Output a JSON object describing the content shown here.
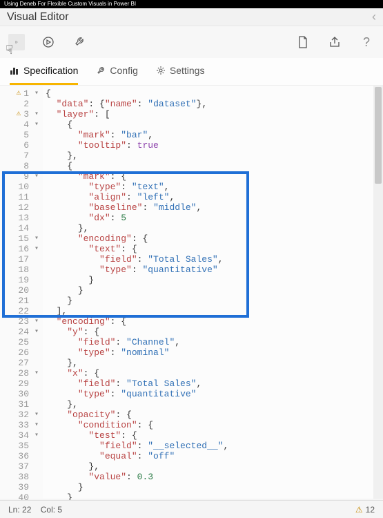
{
  "video_title": "Using Deneb For Flexible Custom Visuals in Power BI",
  "window_title": "Visual Editor",
  "tabs": {
    "spec": "Specification",
    "config": "Config",
    "settings": "Settings"
  },
  "status": {
    "line_label": "Ln:",
    "line": "22",
    "col_label": "Col:",
    "col": "5",
    "warn_count": "12"
  },
  "code": [
    "{",
    "  \"data\": {\"name\": \"dataset\"},",
    "  \"layer\": [",
    "    {",
    "      \"mark\": \"bar\",",
    "      \"tooltip\": true",
    "    },",
    "    {",
    "      \"mark\": {",
    "        \"type\": \"text\",",
    "        \"align\": \"left\",",
    "        \"baseline\": \"middle\",",
    "        \"dx\": 5",
    "      },",
    "      \"encoding\": {",
    "        \"text\": {",
    "          \"field\": \"Total Sales\",",
    "          \"type\": \"quantitative\"",
    "        }",
    "      }",
    "    }",
    "  ],",
    "  \"encoding\": {",
    "    \"y\": {",
    "      \"field\": \"Channel\",",
    "      \"type\": \"nominal\"",
    "    },",
    "    \"x\": {",
    "      \"field\": \"Total Sales\",",
    "      \"type\": \"quantitative\"",
    "    },",
    "    \"opacity\": {",
    "      \"condition\": {",
    "        \"test\": {",
    "          \"field\": \"__selected__\",",
    "          \"equal\": \"off\"",
    "        },",
    "        \"value\": 0.3",
    "      }",
    "    }"
  ],
  "gutter": {
    "warn_lines": [
      1,
      3
    ],
    "fold_lines": [
      1,
      3,
      4,
      9,
      15,
      16,
      23,
      24,
      28,
      32,
      33,
      34
    ]
  }
}
